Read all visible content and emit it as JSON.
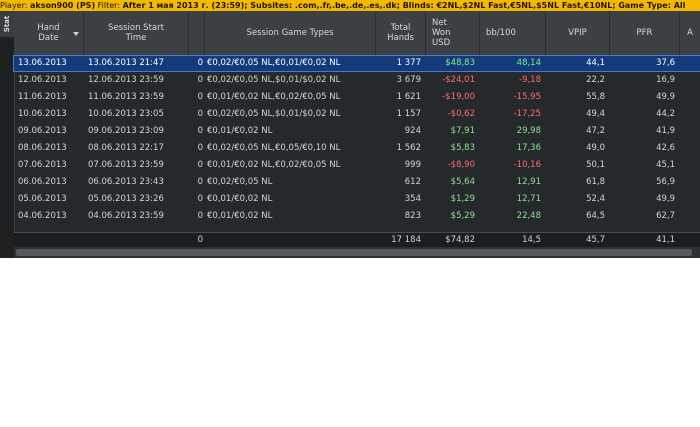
{
  "filter_bar": {
    "player_label": "Player:",
    "player_value": "akson900 (PS)",
    "filter_label": "Filter:",
    "filter_value": "After 1 мая 2013 г. (23:59); Subsites: .com,.fr,.be,.de,.es,.dk; Blinds: €2NL,$2NL Fast,€5NL,$5NL Fast,€10NL; Game Type: All"
  },
  "side_tab": {
    "label": "Stat"
  },
  "columns": [
    {
      "key": "hand_date",
      "label_line1": "Hand",
      "label_line2": "Date",
      "label_line3": ""
    },
    {
      "key": "session_start",
      "label_line1": "Session Start",
      "label_line2": "Time",
      "label_line3": ""
    },
    {
      "key": "blank",
      "label_line1": "",
      "label_line2": "",
      "label_line3": ""
    },
    {
      "key": "game_types",
      "label_line1": "Session Game Types",
      "label_line2": "",
      "label_line3": ""
    },
    {
      "key": "total_hands",
      "label_line1": "Total",
      "label_line2": "Hands",
      "label_line3": ""
    },
    {
      "key": "net_won",
      "label_line1": "Net",
      "label_line2": "Won",
      "label_line3": "USD"
    },
    {
      "key": "bb100",
      "label_line1": "bb/100",
      "label_line2": "",
      "label_line3": ""
    },
    {
      "key": "vpip",
      "label_line1": "VPIP",
      "label_line2": "",
      "label_line3": ""
    },
    {
      "key": "pfr",
      "label_line1": "PFR",
      "label_line2": "",
      "label_line3": ""
    },
    {
      "key": "extra",
      "label_line1": "A",
      "label_line2": "",
      "label_line3": ""
    }
  ],
  "rows": [
    {
      "hand_date": "13.06.2013",
      "session_start": "13.06.2013 21:47",
      "zero": "0",
      "game_types": "€0,02/€0,05 NL,€0,01/€0,02 NL",
      "total_hands": "1 377",
      "net_won": "$48,83",
      "bb100": "48,14",
      "vpip": "44,1",
      "pfr": "37,6",
      "sign": "pos"
    },
    {
      "hand_date": "12.06.2013",
      "session_start": "12.06.2013 23:59",
      "zero": "0",
      "game_types": "€0,02/€0,05 NL,$0,01/$0,02 NL",
      "total_hands": "3 679",
      "net_won": "-$24,01",
      "bb100": "-9,18",
      "vpip": "22,2",
      "pfr": "16,9",
      "sign": "neg"
    },
    {
      "hand_date": "11.06.2013",
      "session_start": "11.06.2013 23:59",
      "zero": "0",
      "game_types": "€0,01/€0,02 NL,€0,02/€0,05 NL",
      "total_hands": "1 621",
      "net_won": "-$19,00",
      "bb100": "-15,95",
      "vpip": "55,8",
      "pfr": "49,9",
      "sign": "neg"
    },
    {
      "hand_date": "10.06.2013",
      "session_start": "10.06.2013 23:05",
      "zero": "0",
      "game_types": "€0,02/€0,05 NL,$0,01/$0,02 NL",
      "total_hands": "1 157",
      "net_won": "-$0,62",
      "bb100": "-17,25",
      "vpip": "49,4",
      "pfr": "44,2",
      "sign": "neg"
    },
    {
      "hand_date": "09.06.2013",
      "session_start": "09.06.2013 23:09",
      "zero": "0",
      "game_types": "€0,01/€0,02 NL",
      "total_hands": "924",
      "net_won": "$7,91",
      "bb100": "29,98",
      "vpip": "47,2",
      "pfr": "41,9",
      "sign": "pos"
    },
    {
      "hand_date": "08.06.2013",
      "session_start": "08.06.2013 22:17",
      "zero": "0",
      "game_types": "€0,02/€0,05 NL,€0,05/€0,10 NL",
      "total_hands": "1 562",
      "net_won": "$5,83",
      "bb100": "17,36",
      "vpip": "49,0",
      "pfr": "42,6",
      "sign": "pos"
    },
    {
      "hand_date": "07.06.2013",
      "session_start": "07.06.2013 23:59",
      "zero": "0",
      "game_types": "€0,01/€0,02 NL,€0,02/€0,05 NL",
      "total_hands": "999",
      "net_won": "-$8,90",
      "bb100": "-10,16",
      "vpip": "50,1",
      "pfr": "45,1",
      "sign": "neg"
    },
    {
      "hand_date": "06.06.2013",
      "session_start": "06.06.2013 23:43",
      "zero": "0",
      "game_types": "€0,02/€0,05 NL",
      "total_hands": "612",
      "net_won": "$5,64",
      "bb100": "12,91",
      "vpip": "61,8",
      "pfr": "56,9",
      "sign": "pos"
    },
    {
      "hand_date": "05.06.2013",
      "session_start": "05.06.2013 23:26",
      "zero": "0",
      "game_types": "€0,01/€0,02 NL",
      "total_hands": "354",
      "net_won": "$1,29",
      "bb100": "12,71",
      "vpip": "52,4",
      "pfr": "49,9",
      "sign": "pos"
    },
    {
      "hand_date": "04.06.2013",
      "session_start": "04.06.2013 23:59",
      "zero": "0",
      "game_types": "€0,01/€0,02 NL",
      "total_hands": "823",
      "net_won": "$5,29",
      "bb100": "22,48",
      "vpip": "64,5",
      "pfr": "62,7",
      "sign": "pos"
    }
  ],
  "totals": {
    "zero": "0",
    "total_hands": "17 184",
    "net_won": "$74,82",
    "bb100": "14,5",
    "vpip": "45,7",
    "pfr": "41,1"
  },
  "colors": {
    "filter_bar": "#f5b800",
    "positive": "#8fe08f",
    "negative": "#ff6b6b",
    "selection": "#143a7c"
  }
}
